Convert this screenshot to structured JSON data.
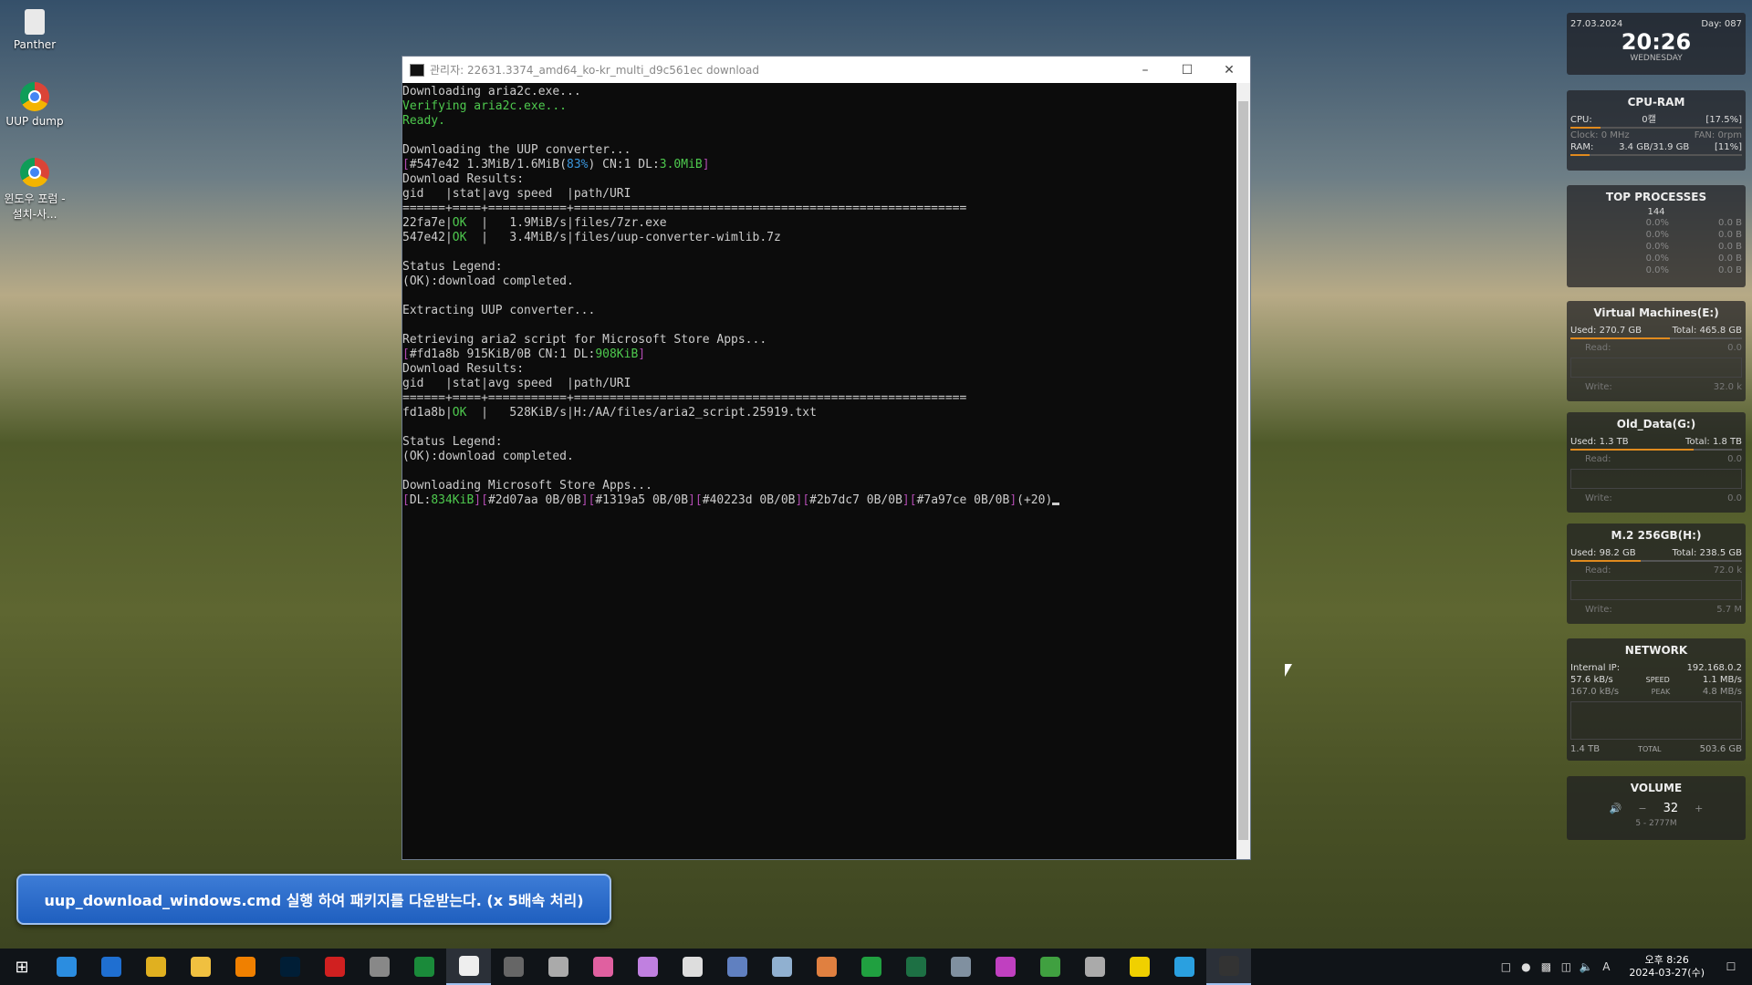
{
  "desktop": {
    "icons": [
      {
        "label": "Panther"
      },
      {
        "label": "UUP dump"
      },
      {
        "label": "윈도우 포럼 - 설치-사..."
      }
    ]
  },
  "console": {
    "title": "관리자:  22631.3374_amd64_ko-kr_multi_d9c561ec download",
    "lines": [
      [
        {
          "t": "Downloading aria2c.exe...",
          "c": "w"
        }
      ],
      [
        {
          "t": "Verifying aria2c.exe...",
          "c": "g"
        }
      ],
      [
        {
          "t": "Ready.",
          "c": "g"
        }
      ],
      [
        {
          "t": "",
          "c": "w"
        }
      ],
      [
        {
          "t": "Downloading the UUP converter...",
          "c": "w"
        }
      ],
      [
        {
          "t": "[",
          "c": "m"
        },
        {
          "t": "#547e42 1.3MiB/1.6MiB(",
          "c": "w"
        },
        {
          "t": "83%",
          "c": "c"
        },
        {
          "t": ") CN:1 DL:",
          "c": "w"
        },
        {
          "t": "3.0MiB",
          "c": "g"
        },
        {
          "t": "]",
          "c": "m"
        }
      ],
      [
        {
          "t": "Download Results:",
          "c": "w"
        }
      ],
      [
        {
          "t": "gid   |stat|avg speed  |path/URI",
          "c": "w"
        }
      ],
      [
        {
          "t": "======+====+===========+=======================================================",
          "c": "w"
        }
      ],
      [
        {
          "t": "22fa7e|",
          "c": "w"
        },
        {
          "t": "OK",
          "c": "g"
        },
        {
          "t": "  |   1.9MiB/s|files/7zr.exe",
          "c": "w"
        }
      ],
      [
        {
          "t": "547e42|",
          "c": "w"
        },
        {
          "t": "OK",
          "c": "g"
        },
        {
          "t": "  |   3.4MiB/s|files/uup-converter-wimlib.7z",
          "c": "w"
        }
      ],
      [
        {
          "t": "",
          "c": "w"
        }
      ],
      [
        {
          "t": "Status Legend:",
          "c": "w"
        }
      ],
      [
        {
          "t": "(OK):download completed.",
          "c": "w"
        }
      ],
      [
        {
          "t": "",
          "c": "w"
        }
      ],
      [
        {
          "t": "Extracting UUP converter...",
          "c": "w"
        }
      ],
      [
        {
          "t": "",
          "c": "w"
        }
      ],
      [
        {
          "t": "Retrieving aria2 script for Microsoft Store Apps...",
          "c": "w"
        }
      ],
      [
        {
          "t": "[",
          "c": "m"
        },
        {
          "t": "#fd1a8b 915KiB/0B CN:1 DL:",
          "c": "w"
        },
        {
          "t": "908KiB",
          "c": "g"
        },
        {
          "t": "]",
          "c": "m"
        }
      ],
      [
        {
          "t": "Download Results:",
          "c": "w"
        }
      ],
      [
        {
          "t": "gid   |stat|avg speed  |path/URI",
          "c": "w"
        }
      ],
      [
        {
          "t": "======+====+===========+=======================================================",
          "c": "w"
        }
      ],
      [
        {
          "t": "fd1a8b|",
          "c": "w"
        },
        {
          "t": "OK",
          "c": "g"
        },
        {
          "t": "  |   528KiB/s|H:/AA/files/aria2_script.25919.txt",
          "c": "w"
        }
      ],
      [
        {
          "t": "",
          "c": "w"
        }
      ],
      [
        {
          "t": "Status Legend:",
          "c": "w"
        }
      ],
      [
        {
          "t": "(OK):download completed.",
          "c": "w"
        }
      ],
      [
        {
          "t": "",
          "c": "w"
        }
      ],
      [
        {
          "t": "Downloading Microsoft Store Apps...",
          "c": "w"
        }
      ],
      [
        {
          "t": "[",
          "c": "m"
        },
        {
          "t": "DL:",
          "c": "w"
        },
        {
          "t": "834KiB",
          "c": "g"
        },
        {
          "t": "][",
          "c": "m"
        },
        {
          "t": "#2d07aa 0B/0B",
          "c": "w"
        },
        {
          "t": "][",
          "c": "m"
        },
        {
          "t": "#1319a5 0B/0B",
          "c": "w"
        },
        {
          "t": "][",
          "c": "m"
        },
        {
          "t": "#40223d 0B/0B",
          "c": "w"
        },
        {
          "t": "][",
          "c": "m"
        },
        {
          "t": "#2b7dc7 0B/0B",
          "c": "w"
        },
        {
          "t": "][",
          "c": "m"
        },
        {
          "t": "#7a97ce 0B/0B",
          "c": "w"
        },
        {
          "t": "]",
          "c": "m"
        },
        {
          "t": "(+20)",
          "c": "w"
        }
      ]
    ]
  },
  "widgets": {
    "clock": {
      "date": "27.03.2024",
      "day": "Day: 087",
      "time": "20:26",
      "weekday": "WEDNESDAY"
    },
    "cpuram": {
      "title": "CPU-RAM",
      "cpu_label": "CPU:",
      "cpu_temp": "0캘",
      "cpu_pct": "[17.5%]",
      "clock": "Clock: 0 MHz",
      "fan": "FAN: 0rpm",
      "ram_label": "RAM:",
      "ram_val": "3.4 GB/31.9 GB",
      "ram_pct": "[11%]"
    },
    "top": {
      "title": "TOP PROCESSES",
      "count": "144",
      "rows": [
        [
          "0.0%",
          "0.0 B"
        ],
        [
          "0.0%",
          "0.0 B"
        ],
        [
          "0.0%",
          "0.0 B"
        ],
        [
          "0.0%",
          "0.0 B"
        ],
        [
          "0.0%",
          "0.0 B"
        ]
      ]
    },
    "drives": [
      {
        "title": "Virtual Machines(E:)",
        "used": "Used: 270.7 GB",
        "total": "Total: 465.8 GB",
        "read": "Read:",
        "read_v": "0.0",
        "write": "Write:",
        "write_v": "32.0 k",
        "fill": 0.58
      },
      {
        "title": "Old_Data(G:)",
        "used": "Used: 1.3 TB",
        "total": "Total: 1.8 TB",
        "read": "Read:",
        "read_v": "0.0",
        "write": "Write:",
        "write_v": "0.0",
        "fill": 0.72
      },
      {
        "title": "M.2 256GB(H:)",
        "used": "Used: 98.2 GB",
        "total": "Total: 238.5 GB",
        "read": "Read:",
        "read_v": "72.0 k",
        "write": "Write:",
        "write_v": "5.7 M",
        "fill": 0.41
      }
    ],
    "network": {
      "title": "NETWORK",
      "ip_label": "Internal IP:",
      "ip": "192.168.0.2",
      "up": "57.6 kB/s",
      "speed_label": "SPEED",
      "speed": "1.1 MB/s",
      "down": "167.0 kB/s",
      "peak_label": "PEAK",
      "peak": "4.8 MB/s",
      "total_up": "1.4 TB",
      "total_label": "TOTAL",
      "total_down": "503.6 GB"
    },
    "volume": {
      "title": "VOLUME",
      "level": "32",
      "device": "5 - 2777M"
    }
  },
  "notice": {
    "text": "uup_download_windows.cmd 실행 하여 패키지를 다운받는다. (x 5배속 처리)"
  },
  "taskbar": {
    "apps": [
      "edge-icon",
      "ie-icon",
      "chrome-icon",
      "explorer-icon",
      "avast-icon",
      "photoshop-icon",
      "app-red-icon",
      "app-script-icon",
      "app-green-c-icon",
      "app-c-active-icon",
      "app-cd-icon",
      "app-tag-icon",
      "app-pink-icon",
      "app-info-icon",
      "app-d-icon",
      "app-blue-icon",
      "app-pen-icon",
      "app-orange-icon",
      "app-green-arrow-icon",
      "excel-icon",
      "app-doc-icon",
      "app-media-icon",
      "utorrent-icon",
      "app-monitor-icon",
      "kakaotalk-icon",
      "app-frame-icon",
      "terminal-icon"
    ],
    "app_colors": [
      "#2b8de0",
      "#1f6fd1",
      "#e0b020",
      "#f0c040",
      "#f08000",
      "#001e36",
      "#d02020",
      "#888",
      "#1a8a3a",
      "#eee",
      "#666",
      "#aaa",
      "#e060a0",
      "#c080e0",
      "#ddd",
      "#6080c0",
      "#90b0d0",
      "#e08040",
      "#20a040",
      "#1d7044",
      "#8090a0",
      "#c040c0",
      "#40a040",
      "#aaa",
      "#f0d000",
      "#2aa0e0",
      "#333"
    ],
    "clock_time": "오후 8:26",
    "clock_date": "2024-03-27(수)",
    "ime": "A"
  }
}
